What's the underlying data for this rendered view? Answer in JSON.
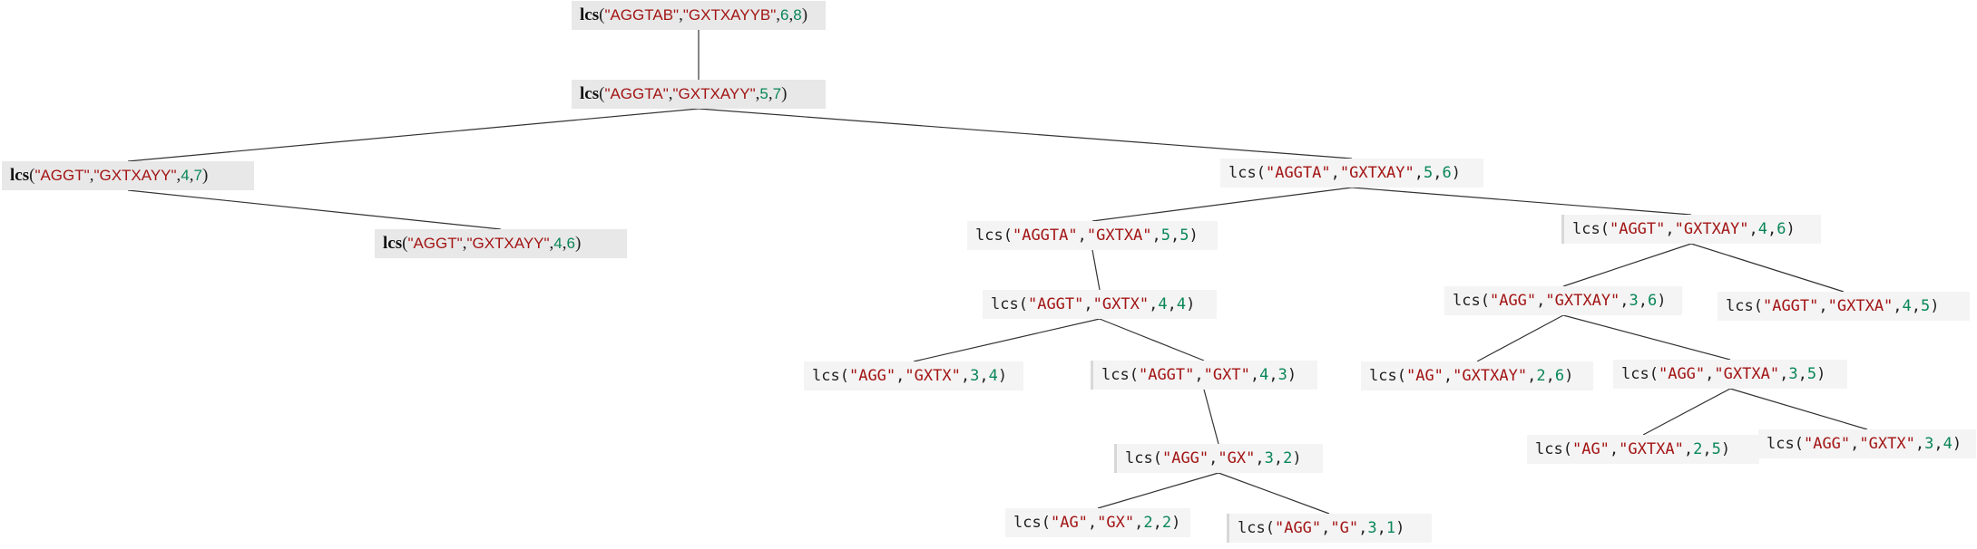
{
  "diagram": {
    "nodes": [
      {
        "id": "n0",
        "fn": "lcs",
        "s1": "\"AGGTAB\"",
        "s2": "\"GXTXAYYB\"",
        "a": "6",
        "b": "8",
        "style": "serif"
      },
      {
        "id": "n1",
        "fn": "lcs",
        "s1": "\"AGGTA\"",
        "s2": "\"GXTXAYY\"",
        "a": "5",
        "b": "7",
        "style": "serif"
      },
      {
        "id": "n2",
        "fn": "lcs",
        "s1": "\"AGGT\"",
        "s2": "\"GXTXAYY\"",
        "a": "4",
        "b": "7",
        "style": "serif"
      },
      {
        "id": "n3",
        "fn": "lcs",
        "s1": "\"AGGT\"",
        "s2": "\"GXTXAYY\"",
        "a": "4",
        "b": "6",
        "style": "serif"
      },
      {
        "id": "n4",
        "fn": "lcs",
        "s1": "\"AGGTA\"",
        "s2": "\"GXTXAY\"",
        "a": "5",
        "b": "6",
        "style": "mono"
      },
      {
        "id": "n5",
        "fn": "lcs",
        "s1": "\"AGGTA\"",
        "s2": "\"GXTXA\"",
        "a": "5",
        "b": "5",
        "style": "mono"
      },
      {
        "id": "n6",
        "fn": "lcs",
        "s1": "\"AGGT\"",
        "s2": "\"GXTXAY\"",
        "a": "4",
        "b": "6",
        "style": "mono"
      },
      {
        "id": "n7",
        "fn": "lcs",
        "s1": "\"AGGT\"",
        "s2": "\"GXTX\"",
        "a": "4",
        "b": "4",
        "style": "mono"
      },
      {
        "id": "n8",
        "fn": "lcs",
        "s1": "\"AGG\"",
        "s2": "\"GXTXAY\"",
        "a": "3",
        "b": "6",
        "style": "mono"
      },
      {
        "id": "n9",
        "fn": "lcs",
        "s1": "\"AGGT\"",
        "s2": "\"GXTXA\"",
        "a": "4",
        "b": "5",
        "style": "mono"
      },
      {
        "id": "n10",
        "fn": "lcs",
        "s1": "\"AGG\"",
        "s2": "\"GXTX\"",
        "a": "3",
        "b": "4",
        "style": "mono"
      },
      {
        "id": "n11",
        "fn": "lcs",
        "s1": "\"AGGT\"",
        "s2": "\"GXT\"",
        "a": "4",
        "b": "3",
        "style": "mono"
      },
      {
        "id": "n12",
        "fn": "lcs",
        "s1": "\"AG\"",
        "s2": "\"GXTXAY\"",
        "a": "2",
        "b": "6",
        "style": "mono"
      },
      {
        "id": "n13",
        "fn": "lcs",
        "s1": "\"AGG\"",
        "s2": "\"GXTXA\"",
        "a": "3",
        "b": "5",
        "style": "mono"
      },
      {
        "id": "n14",
        "fn": "lcs",
        "s1": "\"AGG\"",
        "s2": "\"GX\"",
        "a": "3",
        "b": "2",
        "style": "mono"
      },
      {
        "id": "n15",
        "fn": "lcs",
        "s1": "\"AG\"",
        "s2": "\"GXTXA\"",
        "a": "2",
        "b": "5",
        "style": "mono"
      },
      {
        "id": "n16",
        "fn": "lcs",
        "s1": "\"AGG\"",
        "s2": "\"GXTX\"",
        "a": "3",
        "b": "4",
        "style": "mono"
      },
      {
        "id": "n17",
        "fn": "lcs",
        "s1": "\"AG\"",
        "s2": "\"GX\"",
        "a": "2",
        "b": "2",
        "style": "mono"
      },
      {
        "id": "n18",
        "fn": "lcs",
        "s1": "\"AGG\"",
        "s2": "\"G\"",
        "a": "3",
        "b": "1",
        "style": "mono"
      }
    ],
    "edges": [
      [
        "n0",
        "n1"
      ],
      [
        "n1",
        "n2"
      ],
      [
        "n1",
        "n4"
      ],
      [
        "n2",
        "n3"
      ],
      [
        "n4",
        "n5"
      ],
      [
        "n4",
        "n6"
      ],
      [
        "n5",
        "n7"
      ],
      [
        "n6",
        "n8"
      ],
      [
        "n6",
        "n9"
      ],
      [
        "n7",
        "n10"
      ],
      [
        "n7",
        "n11"
      ],
      [
        "n8",
        "n12"
      ],
      [
        "n8",
        "n13"
      ],
      [
        "n11",
        "n14"
      ],
      [
        "n13",
        "n15"
      ],
      [
        "n13",
        "n16"
      ],
      [
        "n14",
        "n17"
      ],
      [
        "n14",
        "n18"
      ]
    ],
    "colors": {
      "string": "#a31515",
      "number": "#098658",
      "edge": "#333333",
      "node_bg": "#f4f4f4"
    }
  }
}
